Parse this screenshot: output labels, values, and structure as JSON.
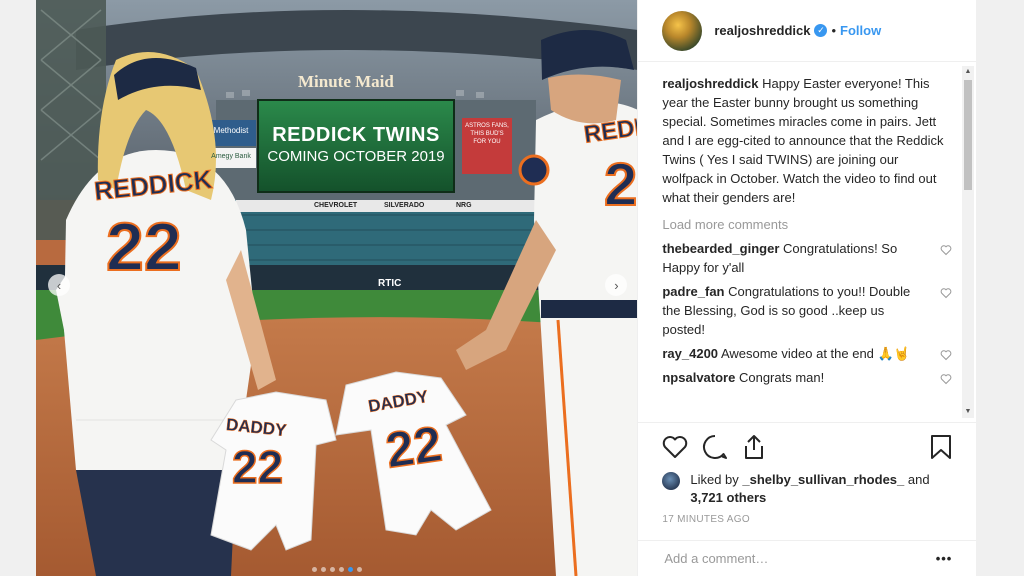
{
  "post": {
    "photo": {
      "stadium_sign": "Minute Maid",
      "screen_line1": "REDDICK TWINS",
      "screen_line2": "COMING OCTOBER 2019",
      "ad_left": "Methodist",
      "ad_left2": "Amegy Bank",
      "ad_right": "ASTROS FANS, THIS BUD'S FOR YOU",
      "banner1": "CHEVROLET",
      "banner2": "SILVERADO",
      "banner3": "NRG",
      "wall_ad": "RTIC",
      "jersey_name": "REDDICK",
      "jersey_number": "22",
      "baby_text": "DADDY",
      "baby_number": "22",
      "prev_icon": "chevron-left-icon",
      "next_icon": "chevron-right-icon",
      "dots_total": 6,
      "dots_active": 5
    },
    "header": {
      "username": "realjoshreddick",
      "verified_icon": "verified-badge-icon",
      "separator": "•",
      "follow_label": "Follow"
    },
    "caption": {
      "username": "realjoshreddick",
      "text": "Happy Easter everyone! This year the Easter bunny brought us something special. Sometimes miracles come in pairs. Jett and I are egg-cited to announce that the Reddick Twins ( Yes I said TWINS) are joining our wolfpack in October. Watch the video to find out what their genders are!"
    },
    "load_more": "Load more comments",
    "comments": [
      {
        "username": "thebearded_ginger",
        "text": "Congratulations! So Happy for y'all"
      },
      {
        "username": "padre_fan",
        "text": "Congratulations to you!! Double the Blessing, God is so good ..keep us posted!"
      },
      {
        "username": "ray_4200",
        "text": "Awesome video at the end 🙏🤘"
      },
      {
        "username": "npsalvatore",
        "text": "Congrats man!"
      }
    ],
    "likes": {
      "prefix": "Liked by",
      "user": "_shelby_sullivan_rhodes_",
      "middle": "and",
      "others": "3,721 others"
    },
    "timestamp": "17 MINUTES AGO",
    "add_comment_placeholder": "Add a comment…",
    "more_label": "•••",
    "colors": {
      "accent": "#3897f0",
      "jersey_navy": "#1f2d53",
      "jersey_orange": "#eb6e1f",
      "screen_green": "#1f6b3a"
    }
  }
}
